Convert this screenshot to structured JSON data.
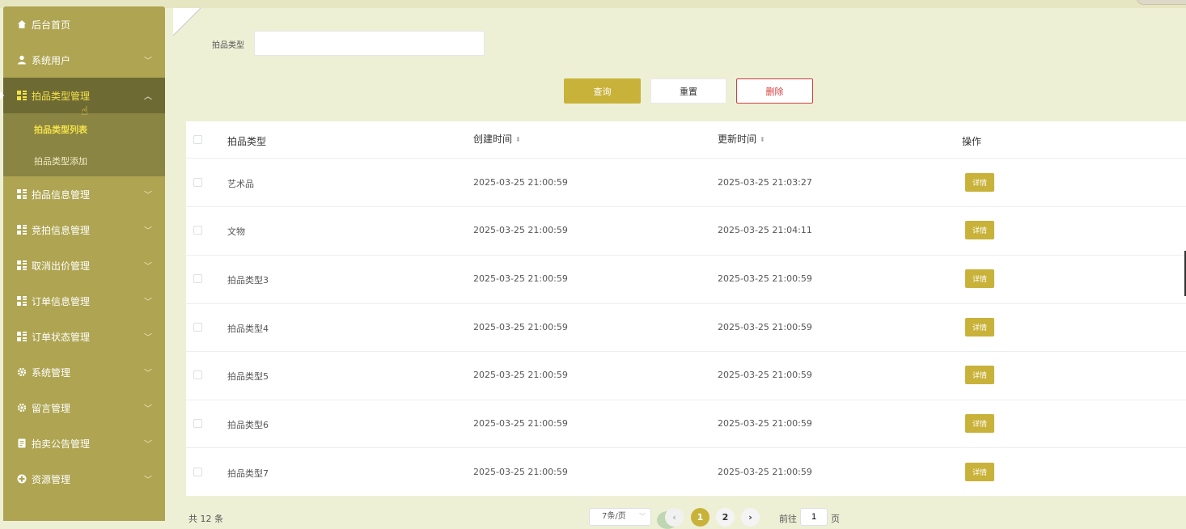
{
  "sidebar": {
    "items": [
      {
        "label": "后台首页",
        "icon": "home-icon",
        "chevron": ""
      },
      {
        "label": "系统用户",
        "icon": "user-icon",
        "chevron": "﹀"
      },
      {
        "label": "拍品类型管理",
        "icon": "grid-icon",
        "chevron": "︿"
      },
      {
        "label": "拍品信息管理",
        "icon": "grid-icon",
        "chevron": "﹀"
      },
      {
        "label": "竞拍信息管理",
        "icon": "grid-icon",
        "chevron": "﹀"
      },
      {
        "label": "取消出价管理",
        "icon": "grid-icon",
        "chevron": "﹀"
      },
      {
        "label": "订单信息管理",
        "icon": "grid-icon",
        "chevron": "﹀"
      },
      {
        "label": "订单状态管理",
        "icon": "grid-icon",
        "chevron": "﹀"
      },
      {
        "label": "系统管理",
        "icon": "gear-icon",
        "chevron": "﹀"
      },
      {
        "label": "留言管理",
        "icon": "gear-icon",
        "chevron": "﹀"
      },
      {
        "label": "拍卖公告管理",
        "icon": "document-icon",
        "chevron": "﹀"
      },
      {
        "label": "资源管理",
        "icon": "plus-circle-icon",
        "chevron": "﹀"
      }
    ],
    "submenu": [
      "拍品类型列表",
      "拍品类型添加"
    ]
  },
  "search": {
    "label": "拍品类型",
    "value": "",
    "placeholder": ""
  },
  "buttons": {
    "query": "查询",
    "reset": "重置",
    "delete": "删除"
  },
  "table": {
    "headers": {
      "type": "拍品类型",
      "created": "创建时间",
      "updated": "更新时间",
      "actions": "操作"
    },
    "sort_glyph": "⬍",
    "detail_label": "详情",
    "rows": [
      {
        "type": "艺术品",
        "created": "2025-03-25 21:00:59",
        "updated": "2025-03-25 21:03:27"
      },
      {
        "type": "文物",
        "created": "2025-03-25 21:00:59",
        "updated": "2025-03-25 21:04:11"
      },
      {
        "type": "拍品类型3",
        "created": "2025-03-25 21:00:59",
        "updated": "2025-03-25 21:00:59"
      },
      {
        "type": "拍品类型4",
        "created": "2025-03-25 21:00:59",
        "updated": "2025-03-25 21:00:59"
      },
      {
        "type": "拍品类型5",
        "created": "2025-03-25 21:00:59",
        "updated": "2025-03-25 21:00:59"
      },
      {
        "type": "拍品类型6",
        "created": "2025-03-25 21:00:59",
        "updated": "2025-03-25 21:00:59"
      },
      {
        "type": "拍品类型7",
        "created": "2025-03-25 21:00:59",
        "updated": "2025-03-25 21:00:59"
      }
    ]
  },
  "pagination": {
    "total": "共 12 条",
    "page_size": "7条/页",
    "prev": "‹",
    "pages": [
      "1",
      "2"
    ],
    "next": "›",
    "goto_prefix": "前往",
    "goto_value": "1",
    "goto_suffix": "页"
  },
  "colors": {
    "accent": "#c8b23a",
    "sidebar": "#aea451",
    "sidebar_active": "#6e6a34",
    "danger": "#d43d3d",
    "background": "#eef0d6"
  }
}
